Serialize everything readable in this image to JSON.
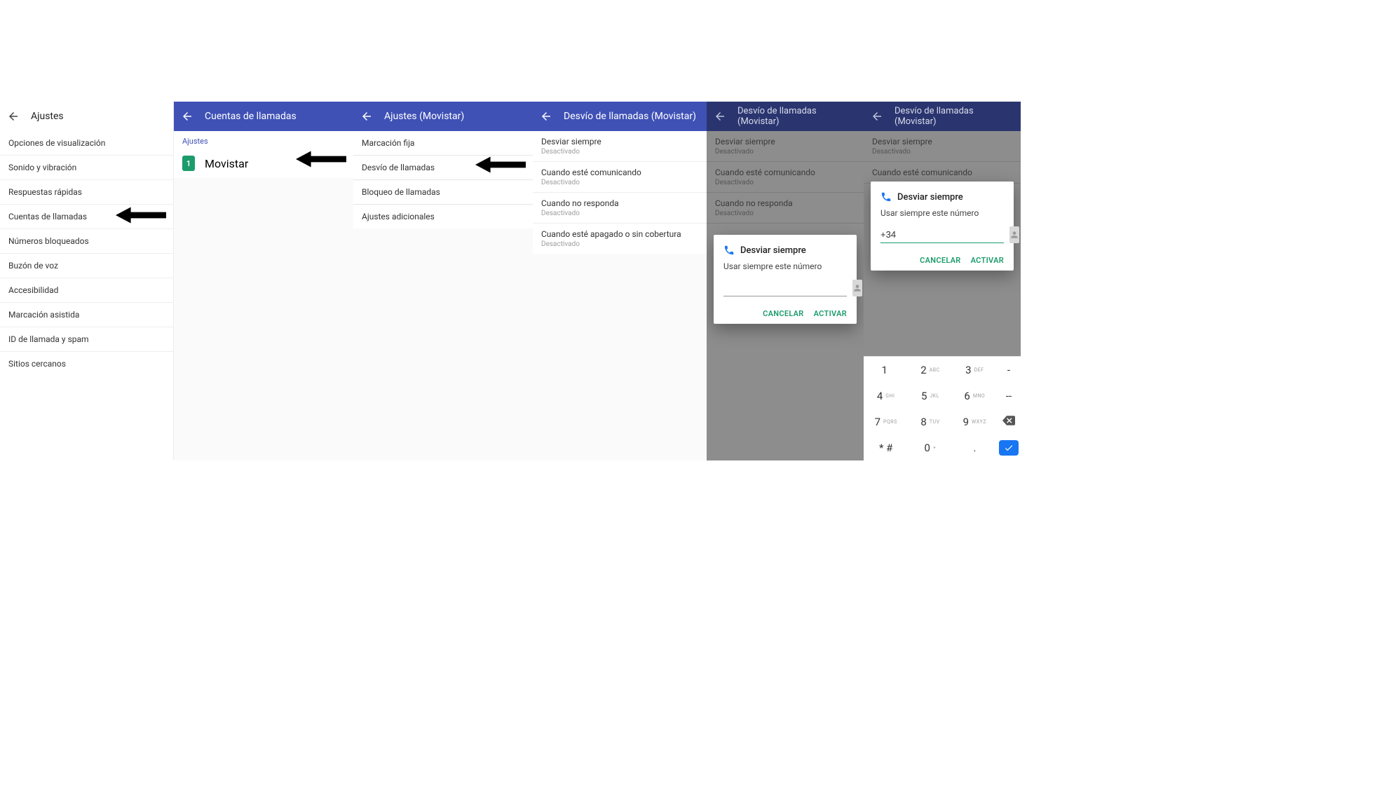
{
  "panel1": {
    "title": "Ajustes",
    "items": [
      "Opciones de visualización",
      "Sonido y vibración",
      "Respuestas rápidas",
      "Cuentas de llamadas",
      "Números bloqueados",
      "Buzón de voz",
      "Accesibilidad",
      "Marcación asistida",
      "ID de llamada y spam",
      "Sitios cercanos"
    ],
    "arrow_on_index": 3
  },
  "panel2": {
    "title": "Cuentas de llamadas",
    "section_label": "Ajustes",
    "sim": {
      "badge": "1",
      "name": "Movistar"
    }
  },
  "panel3": {
    "title": "Ajustes (Movistar)",
    "items": [
      "Marcación fija",
      "Desvío de llamadas",
      "Bloqueo de llamadas",
      "Ajustes adicionales"
    ],
    "arrow_on_index": 1
  },
  "panel4": {
    "title": "Desvío de llamadas (Movistar)",
    "items": [
      {
        "label": "Desviar siempre",
        "status": "Desactivado"
      },
      {
        "label": "Cuando esté comunicando",
        "status": "Desactivado"
      },
      {
        "label": "Cuando no responda",
        "status": "Desactivado"
      },
      {
        "label": "Cuando esté apagado o sin cobertura",
        "status": "Desactivado"
      }
    ]
  },
  "panel5": {
    "title": "Desvío de llamadas (Movistar)",
    "bg_items": [
      {
        "label": "Desviar siempre",
        "status": "Desactivado"
      },
      {
        "label": "Cuando esté comunicando",
        "status": "Desactivado"
      },
      {
        "label": "Cuando no responda",
        "status": "Desactivado"
      }
    ],
    "dialog": {
      "title": "Desviar siempre",
      "subtitle": "Usar siempre este número",
      "input_value": "",
      "cancel": "CANCELAR",
      "confirm": "ACTIVAR"
    }
  },
  "panel6": {
    "title": "Desvío de llamadas (Movistar)",
    "bg_items": [
      {
        "label": "Desviar siempre",
        "status": "Desactivado"
      },
      {
        "label": "Cuando esté comunicando",
        "status": ""
      }
    ],
    "dialog": {
      "title": "Desviar siempre",
      "subtitle": "Usar siempre este número",
      "input_value": "+34",
      "cancel": "CANCELAR",
      "confirm": "ACTIVAR"
    },
    "keypad": {
      "rows": [
        [
          {
            "d": "1",
            "s": ""
          },
          {
            "d": "2",
            "s": "ABC"
          },
          {
            "d": "3",
            "s": "DEF"
          },
          {
            "d": "-",
            "s": ""
          }
        ],
        [
          {
            "d": "4",
            "s": "GHI"
          },
          {
            "d": "5",
            "s": "JKL"
          },
          {
            "d": "6",
            "s": "MNO"
          },
          {
            "d": "--",
            "s": ""
          }
        ],
        [
          {
            "d": "7",
            "s": "PQRS"
          },
          {
            "d": "8",
            "s": "TUV"
          },
          {
            "d": "9",
            "s": "WXYZ"
          },
          {
            "d": "⌫",
            "s": ""
          }
        ],
        [
          {
            "d": "* #",
            "s": ""
          },
          {
            "d": "0",
            "s": "+"
          },
          {
            "d": ".",
            "s": ""
          },
          {
            "d": "✓",
            "s": ""
          }
        ]
      ]
    }
  }
}
